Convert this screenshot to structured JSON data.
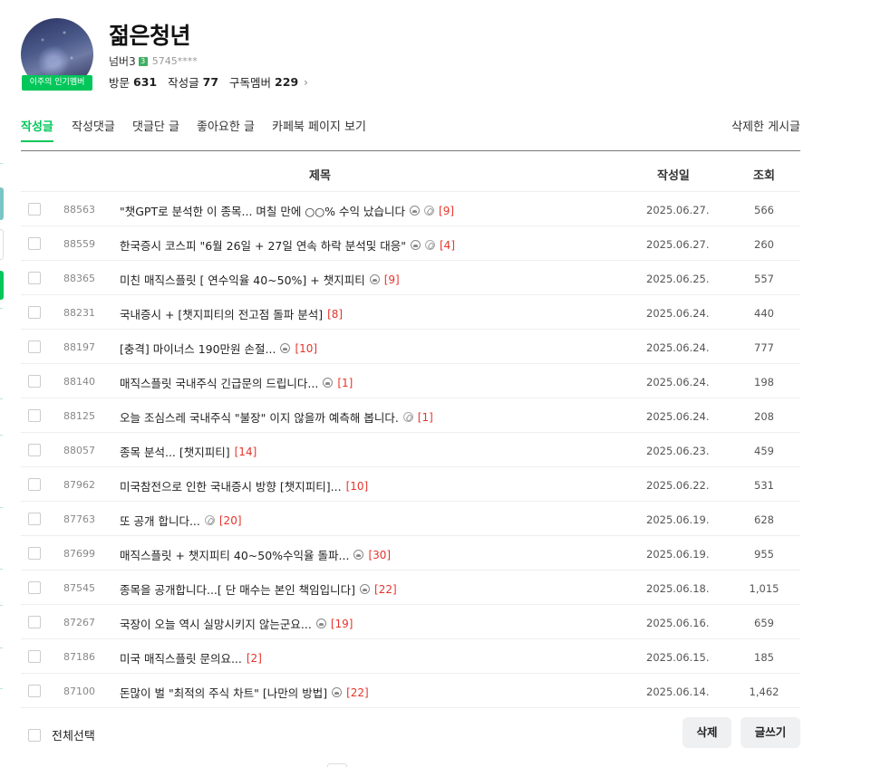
{
  "profile": {
    "nickname": "젊은청년",
    "badge": "이주의 인기멤버",
    "level": "넘버3",
    "level_num": "3",
    "member_id": "5745****",
    "stats": [
      {
        "label": "방문",
        "value": "631"
      },
      {
        "label": "작성글",
        "value": "77"
      },
      {
        "label": "구독멤버",
        "value": "229"
      }
    ]
  },
  "tabs": [
    {
      "label": "작성글",
      "active": true
    },
    {
      "label": "작성댓글",
      "active": false
    },
    {
      "label": "댓글단 글",
      "active": false
    },
    {
      "label": "좋아요한 글",
      "active": false
    },
    {
      "label": "카페북 페이지 보기",
      "active": false
    }
  ],
  "deleted_posts_label": "삭제한 게시글",
  "table": {
    "headers": {
      "title": "제목",
      "date": "작성일",
      "views": "조회"
    },
    "rows": [
      {
        "num": "88563",
        "title": "\"챗GPT로 분석한 이 종목... 며칠 만에 ○○% 수익 났습니다",
        "icons": [
          "img",
          "link"
        ],
        "comments": "[9]",
        "date": "2025.06.27.",
        "views": "566"
      },
      {
        "num": "88559",
        "title": "한국증시 코스피 \"6월 26일 + 27일 연속 하락 분석및 대응\"",
        "icons": [
          "img",
          "link"
        ],
        "comments": "[4]",
        "date": "2025.06.27.",
        "views": "260"
      },
      {
        "num": "88365",
        "title": "미친 매직스플릿 [ 연수익율 40~50%] + 챗지피티",
        "icons": [
          "img"
        ],
        "comments": "[9]",
        "date": "2025.06.25.",
        "views": "557"
      },
      {
        "num": "88231",
        "title": "국내증시 + [챗지피티의 전고점 돌파 분석]",
        "icons": [],
        "comments": "[8]",
        "date": "2025.06.24.",
        "views": "440"
      },
      {
        "num": "88197",
        "title": "[충격] 마이너스 190만원 손절...",
        "icons": [
          "img"
        ],
        "comments": "[10]",
        "date": "2025.06.24.",
        "views": "777"
      },
      {
        "num": "88140",
        "title": "매직스플릿 국내주식 긴급문의 드립니다...",
        "icons": [
          "img"
        ],
        "comments": "[1]",
        "date": "2025.06.24.",
        "views": "198"
      },
      {
        "num": "88125",
        "title": "오늘 조심스레 국내주식 \"불장\" 이지 않을까 예측해 봅니다.",
        "icons": [
          "link"
        ],
        "comments": "[1]",
        "date": "2025.06.24.",
        "views": "208"
      },
      {
        "num": "88057",
        "title": "종목 분석... [챗지피티]",
        "icons": [],
        "comments": "[14]",
        "date": "2025.06.23.",
        "views": "459"
      },
      {
        "num": "87962",
        "title": "미국참전으로 인한 국내증시 방향 [챗지피티]...",
        "icons": [],
        "comments": "[10]",
        "date": "2025.06.22.",
        "views": "531"
      },
      {
        "num": "87763",
        "title": "또 공개 합니다...",
        "icons": [
          "link"
        ],
        "comments": "[20]",
        "date": "2025.06.19.",
        "views": "628"
      },
      {
        "num": "87699",
        "title": "매직스플릿 + 챗지피티 40~50%수익율 돌파...",
        "icons": [
          "img"
        ],
        "comments": "[30]",
        "date": "2025.06.19.",
        "views": "955"
      },
      {
        "num": "87545",
        "title": "종목을 공개합니다...[ 단 매수는 본인 책임입니다]",
        "icons": [
          "img"
        ],
        "comments": "[22]",
        "date": "2025.06.18.",
        "views": "1,015"
      },
      {
        "num": "87267",
        "title": "국장이 오늘 역시 실망시키지 않는군요...",
        "icons": [
          "img"
        ],
        "comments": "[19]",
        "date": "2025.06.16.",
        "views": "659"
      },
      {
        "num": "87186",
        "title": "미국 매직스플릿 문의요...",
        "icons": [],
        "comments": "[2]",
        "date": "2025.06.15.",
        "views": "185"
      },
      {
        "num": "87100",
        "title": "돈많이 벌 \"최적의 주식 차트\" [나만의 방법]",
        "icons": [
          "img"
        ],
        "comments": "[22]",
        "date": "2025.06.14.",
        "views": "1,462"
      }
    ]
  },
  "footer": {
    "select_all": "전체선택",
    "delete_button": "삭제",
    "write_button": "글쓰기"
  },
  "colors": {
    "accent": "#03c75a",
    "comment": "#e5342b"
  }
}
